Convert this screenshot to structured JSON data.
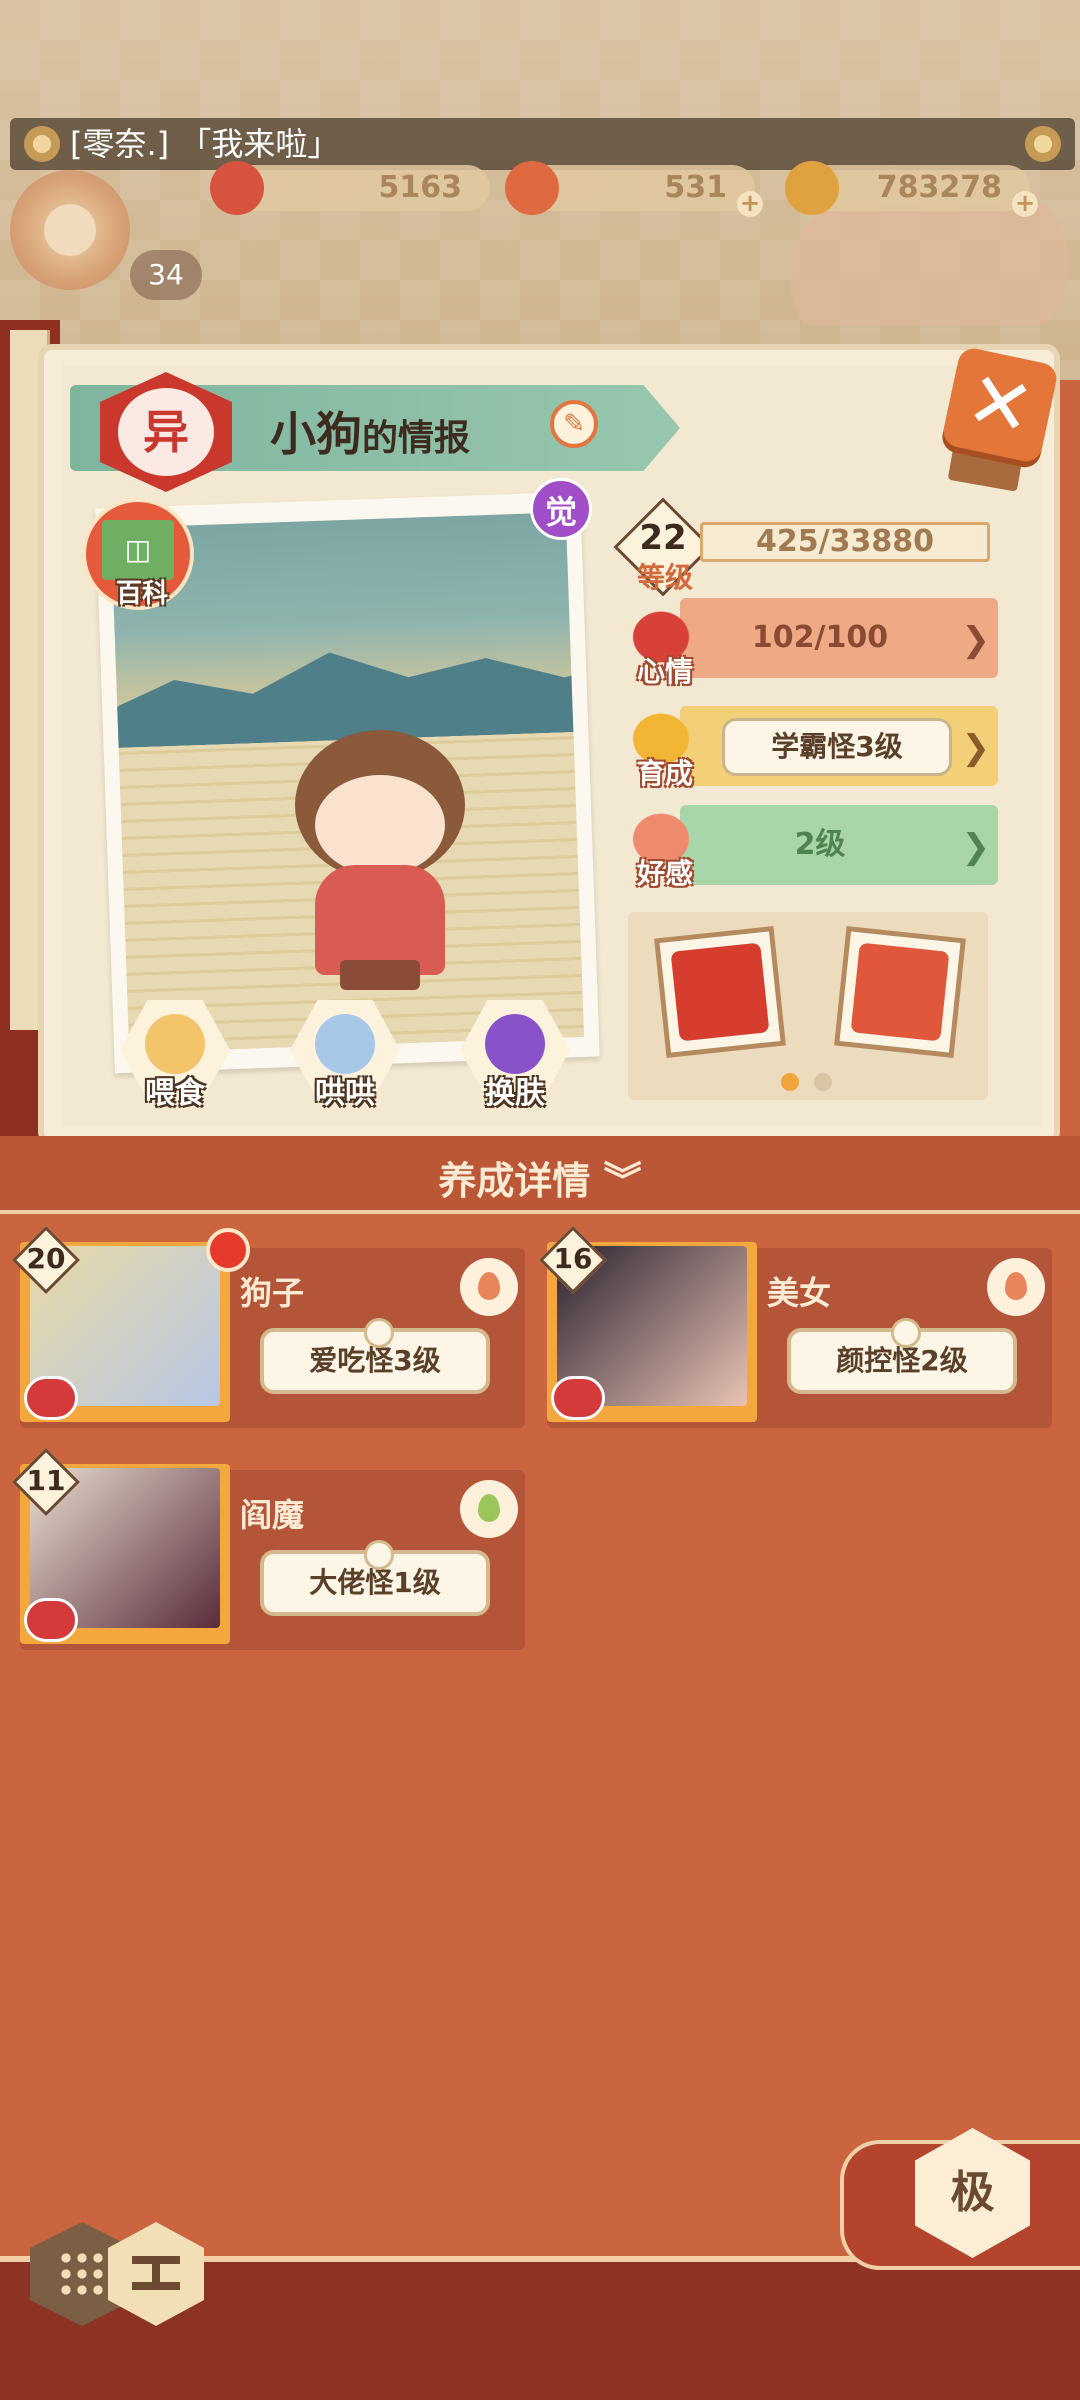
{
  "chat": {
    "text": "[零奈.] 「我来啦」"
  },
  "resources": {
    "petal": "5163",
    "gourd": "531",
    "coin": "783278"
  },
  "player": {
    "level": "34"
  },
  "monster": {
    "title_name": "小狗",
    "title_suffix": "的情报",
    "tag": "异",
    "awaken_badge": "觉",
    "encyclopedia_label": "百科",
    "level": "22",
    "level_label": "等级",
    "exp": "425/33880",
    "mood_label": "心情",
    "mood_value": "102/100",
    "growth_label": "育成",
    "growth_value": "学霸怪3级",
    "affection_label": "好感",
    "affection_value": "2级",
    "actions": [
      "喂食",
      "哄哄",
      "换肤"
    ]
  },
  "detail_section": {
    "title": "养成详情"
  },
  "cards": [
    {
      "level": "20",
      "name": "狗子",
      "trait": "爱吃怪3级",
      "seed_color": "#e8865a"
    },
    {
      "level": "16",
      "name": "美女",
      "trait": "颜控怪2级",
      "seed_color": "#e8865a"
    },
    {
      "level": "11",
      "name": "阎魔",
      "trait": "大佬怪1级",
      "seed_color": "#9cc65c"
    }
  ],
  "bottom": {
    "tier_button": "极"
  },
  "colors": {
    "accent": "#e5763a",
    "mood": "#f0a985",
    "growth": "#f3cf78",
    "affection": "#a8d6a9"
  }
}
